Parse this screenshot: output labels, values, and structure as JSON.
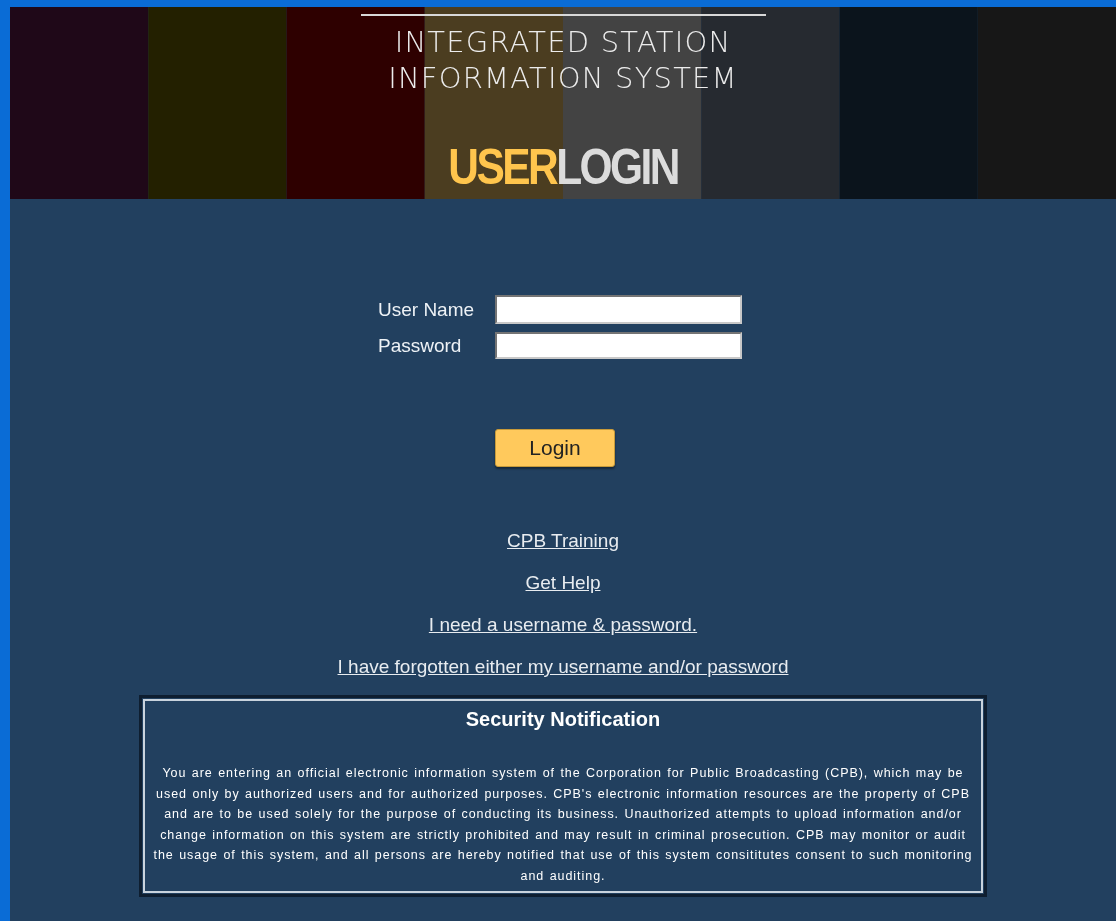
{
  "banner": {
    "title_lines": [
      "INTEGRATED STATION",
      "INFORMATION SYSTEM"
    ],
    "heading": [
      {
        "text": "USER",
        "kind": "accent"
      },
      {
        "text": "LOGIN",
        "kind": "plain"
      }
    ]
  },
  "form": {
    "fields": [
      {
        "label": "User Name"
      },
      {
        "label": "Password"
      }
    ],
    "submit": "Login"
  },
  "links": [
    "CPB Training",
    "Get Help",
    "I need a username & password.",
    "I have forgotten either my username and/or password"
  ],
  "notice": {
    "title": "Security Notification",
    "body": "You are entering an official electronic information system of the Corporation for Public Broadcasting (CPB), which may be used only by authorized users and for authorized purposes. CPB's electronic information resources are the property of CPB and are to be used solely for the purpose of conducting its business. Unauthorized attempts to upload information and/or change information on this system are strictly prohibited and may result in criminal prosecution. CPB may monitor or audit the usage of this system, and all persons are hereby notified that use of this system consititutes consent to such monitoring and auditing."
  }
}
